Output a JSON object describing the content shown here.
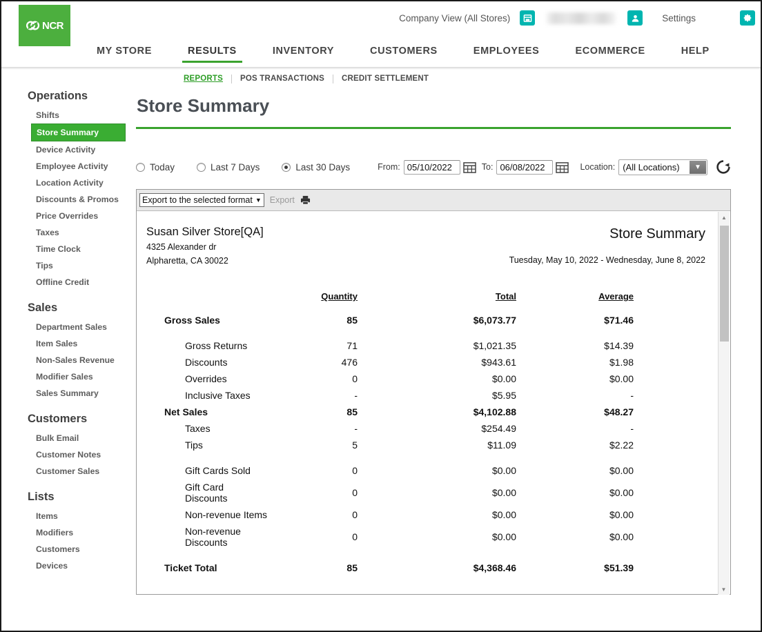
{
  "header": {
    "logo_text": "NCR",
    "company_view": "Company View (All Stores)",
    "store_icon": "store-icon",
    "user_icon": "user-icon",
    "user_name": "",
    "settings_label": "Settings",
    "gear_icon": "gear-icon"
  },
  "mainnav": [
    {
      "label": "MY STORE",
      "active": false
    },
    {
      "label": "RESULTS",
      "active": true
    },
    {
      "label": "INVENTORY",
      "active": false
    },
    {
      "label": "CUSTOMERS",
      "active": false
    },
    {
      "label": "EMPLOYEES",
      "active": false
    },
    {
      "label": "ECOMMERCE",
      "active": false
    },
    {
      "label": "HELP",
      "active": false
    }
  ],
  "subnav": [
    {
      "label": "REPORTS",
      "active": true
    },
    {
      "label": "POS TRANSACTIONS",
      "active": false
    },
    {
      "label": "CREDIT SETTLEMENT",
      "active": false
    }
  ],
  "sidebar": {
    "groups": [
      {
        "title": "Operations",
        "items": [
          {
            "label": "Shifts",
            "active": false
          },
          {
            "label": "Store Summary",
            "active": true
          },
          {
            "label": "Device Activity",
            "active": false
          },
          {
            "label": "Employee Activity",
            "active": false
          },
          {
            "label": "Location Activity",
            "active": false
          },
          {
            "label": "Discounts & Promos",
            "active": false
          },
          {
            "label": "Price Overrides",
            "active": false
          },
          {
            "label": "Taxes",
            "active": false
          },
          {
            "label": "Time Clock",
            "active": false
          },
          {
            "label": "Tips",
            "active": false
          },
          {
            "label": "Offline Credit",
            "active": false
          }
        ]
      },
      {
        "title": "Sales",
        "items": [
          {
            "label": "Department Sales",
            "active": false
          },
          {
            "label": "Item Sales",
            "active": false
          },
          {
            "label": "Non-Sales Revenue",
            "active": false
          },
          {
            "label": "Modifier Sales",
            "active": false
          },
          {
            "label": "Sales Summary",
            "active": false
          }
        ]
      },
      {
        "title": "Customers",
        "items": [
          {
            "label": "Bulk Email",
            "active": false
          },
          {
            "label": "Customer Notes",
            "active": false
          },
          {
            "label": "Customer Sales",
            "active": false
          }
        ]
      },
      {
        "title": "Lists",
        "items": [
          {
            "label": "Items",
            "active": false
          },
          {
            "label": "Modifiers",
            "active": false
          },
          {
            "label": "Customers",
            "active": false
          },
          {
            "label": "Devices",
            "active": false
          }
        ]
      }
    ]
  },
  "page": {
    "title": "Store Summary"
  },
  "filters": {
    "ranges": [
      {
        "label": "Today",
        "checked": false
      },
      {
        "label": "Last 7 Days",
        "checked": false
      },
      {
        "label": "Last 30 Days",
        "checked": true
      }
    ],
    "from_label": "From:",
    "from_value": "05/10/2022",
    "to_label": "To:",
    "to_value": "06/08/2022",
    "calendar_icon": "calendar-icon",
    "location_label": "Location:",
    "location_value": "(All Locations)",
    "refresh_icon": "refresh-icon"
  },
  "toolbar": {
    "export_format": "Export to the selected format",
    "export_label": "Export",
    "print_icon": "printer-icon"
  },
  "report": {
    "store_name": "Susan Silver Store[QA]",
    "address_line1": "4325 Alexander dr",
    "address_line2": "Alpharetta, CA 30022",
    "title": "Store Summary",
    "date_range": "Tuesday, May 10, 2022 - Wednesday, June 8, 2022",
    "columns": [
      "",
      "Quantity",
      "Total",
      "Average"
    ],
    "rows": [
      {
        "label": "Gross Sales",
        "quantity": "85",
        "total": "$6,073.77",
        "average": "$71.46",
        "bold": true,
        "gap": false
      },
      {
        "label": "Gross Returns",
        "quantity": "71",
        "total": "$1,021.35",
        "average": "$14.39",
        "bold": false,
        "gap": true
      },
      {
        "label": "Discounts",
        "quantity": "476",
        "total": "$943.61",
        "average": "$1.98",
        "bold": false,
        "gap": false
      },
      {
        "label": "Overrides",
        "quantity": "0",
        "total": "$0.00",
        "average": "$0.00",
        "bold": false,
        "gap": false
      },
      {
        "label": "Inclusive Taxes",
        "quantity": "-",
        "total": "$5.95",
        "average": "-",
        "bold": false,
        "gap": false
      },
      {
        "label": "Net Sales",
        "quantity": "85",
        "total": "$4,102.88",
        "average": "$48.27",
        "bold": true,
        "gap": false
      },
      {
        "label": "Taxes",
        "quantity": "-",
        "total": "$254.49",
        "average": "-",
        "bold": false,
        "gap": false
      },
      {
        "label": "Tips",
        "quantity": "5",
        "total": "$11.09",
        "average": "$2.22",
        "bold": false,
        "gap": false
      },
      {
        "label": "Gift Cards Sold",
        "quantity": "0",
        "total": "$0.00",
        "average": "$0.00",
        "bold": false,
        "gap": true
      },
      {
        "label": "Gift Card Discounts",
        "quantity": "0",
        "total": "$0.00",
        "average": "$0.00",
        "bold": false,
        "gap": false
      },
      {
        "label": "Non-revenue Items",
        "quantity": "0",
        "total": "$0.00",
        "average": "$0.00",
        "bold": false,
        "gap": false
      },
      {
        "label": "Non-revenue Discounts",
        "quantity": "0",
        "total": "$0.00",
        "average": "$0.00",
        "bold": false,
        "gap": false
      },
      {
        "label": "Ticket Total",
        "quantity": "85",
        "total": "$4,368.46",
        "average": "$51.39",
        "bold": true,
        "gap": false
      }
    ]
  },
  "colors": {
    "brand_green": "#4caf3e",
    "accent_green": "#3aa32e",
    "teal": "#00b5b0"
  }
}
